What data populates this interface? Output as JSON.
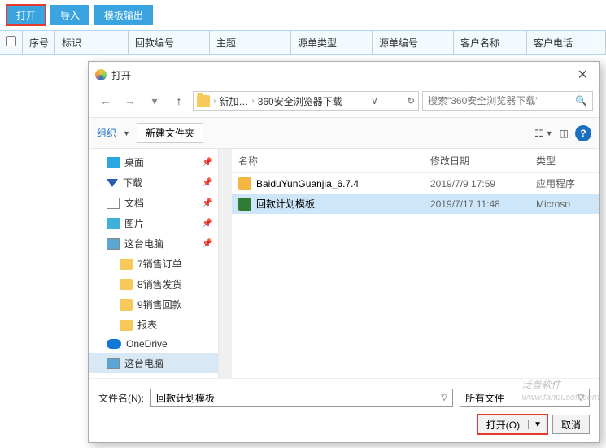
{
  "toolbar": {
    "open": "打开",
    "import": "导入",
    "template_export": "模板输出"
  },
  "grid": {
    "seq": "序号",
    "mark": "标识",
    "code": "回款编号",
    "subject": "主题",
    "src_type": "源单类型",
    "src_code": "源单编号",
    "customer": "客户名称",
    "tel": "客户电话"
  },
  "dialog": {
    "title": "打开",
    "breadcrumb": {
      "part1": "新加…",
      "part2": "360安全浏览器下载"
    },
    "search_placeholder": "搜索\"360安全浏览器下载\"",
    "organize": "组织",
    "new_folder": "新建文件夹",
    "tree": [
      {
        "label": "桌面",
        "icon": "desktop",
        "pinned": true
      },
      {
        "label": "下载",
        "icon": "dl",
        "pinned": true
      },
      {
        "label": "文档",
        "icon": "doc",
        "pinned": true
      },
      {
        "label": "图片",
        "icon": "pic",
        "pinned": true
      },
      {
        "label": "这台电脑",
        "icon": "pc",
        "pinned": true
      },
      {
        "label": "7销售订单",
        "icon": "folder",
        "sub": true
      },
      {
        "label": "8销售发货",
        "icon": "folder",
        "sub": true
      },
      {
        "label": "9销售回款",
        "icon": "folder",
        "sub": true
      },
      {
        "label": "报表",
        "icon": "folder",
        "sub": true
      },
      {
        "label": "OneDrive",
        "icon": "cloud"
      },
      {
        "label": "这台电脑",
        "icon": "pc",
        "selected": true
      }
    ],
    "columns": {
      "name": "名称",
      "modified": "修改日期",
      "type": "类型"
    },
    "files": [
      {
        "name": "BaiduYunGuanjia_6.7.4",
        "modified": "2019/7/9 17:59",
        "type": "应用程序",
        "icon": "exe"
      },
      {
        "name": "回款计划模板",
        "modified": "2019/7/17 11:48",
        "type": "Microso",
        "icon": "xls",
        "selected": true
      }
    ],
    "filename_label": "文件名(N):",
    "filename_value": "回款计划模板",
    "filter_value": "所有文件",
    "open_btn": "打开(O)",
    "cancel_btn": "取消"
  },
  "watermark": {
    "brand": "泛普软件",
    "url": "www.fanpusoft.com"
  }
}
